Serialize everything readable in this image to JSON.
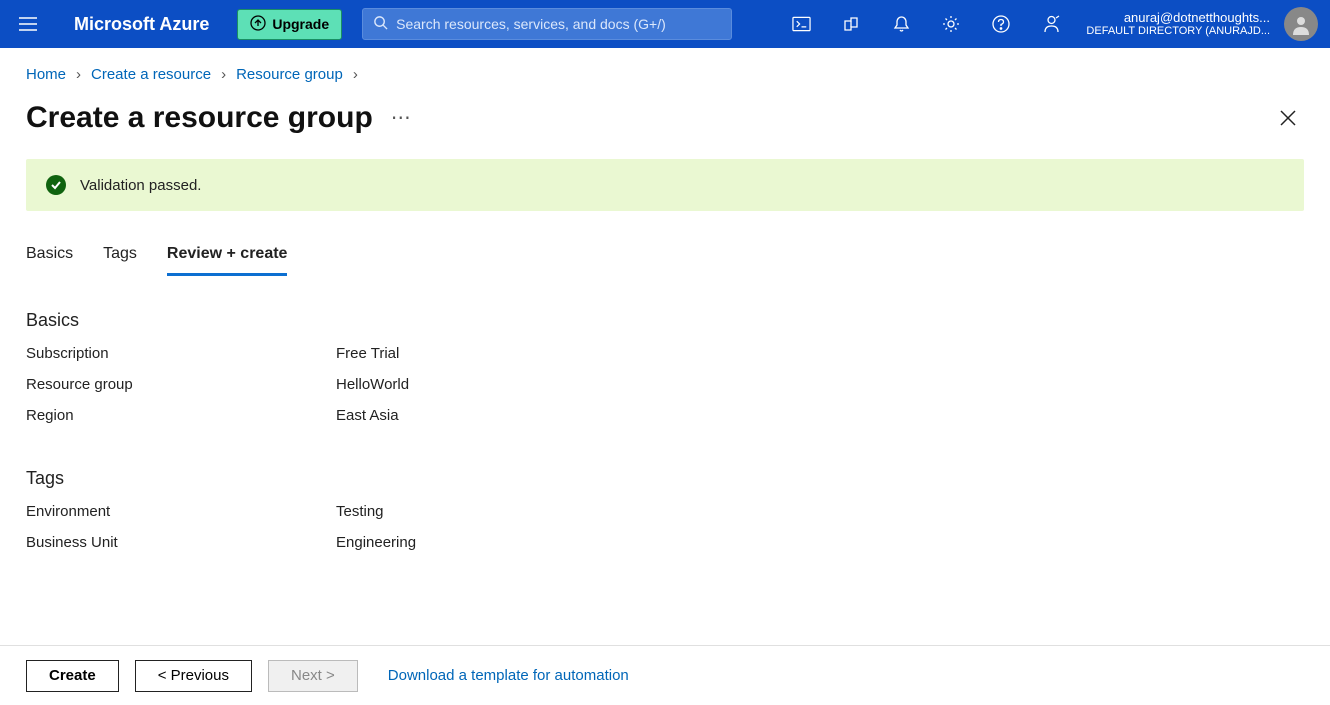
{
  "header": {
    "brand": "Microsoft Azure",
    "upgrade_label": "Upgrade",
    "search_placeholder": "Search resources, services, and docs (G+/)",
    "account_email": "anuraj@dotnetthoughts...",
    "account_directory": "DEFAULT DIRECTORY (ANURAJD..."
  },
  "breadcrumb": {
    "items": [
      "Home",
      "Create a resource",
      "Resource group"
    ]
  },
  "page": {
    "title": "Create a resource group",
    "validation_message": "Validation passed."
  },
  "tabs": {
    "items": [
      {
        "label": "Basics",
        "active": false
      },
      {
        "label": "Tags",
        "active": false
      },
      {
        "label": "Review + create",
        "active": true
      }
    ]
  },
  "sections": {
    "basics": {
      "title": "Basics",
      "rows": [
        {
          "k": "Subscription",
          "v": "Free Trial"
        },
        {
          "k": "Resource group",
          "v": "HelloWorld"
        },
        {
          "k": "Region",
          "v": "East Asia"
        }
      ]
    },
    "tags": {
      "title": "Tags",
      "rows": [
        {
          "k": "Environment",
          "v": "Testing"
        },
        {
          "k": "Business Unit",
          "v": "Engineering"
        }
      ]
    }
  },
  "footer": {
    "create": "Create",
    "previous": "< Previous",
    "next": "Next >",
    "download": "Download a template for automation"
  }
}
